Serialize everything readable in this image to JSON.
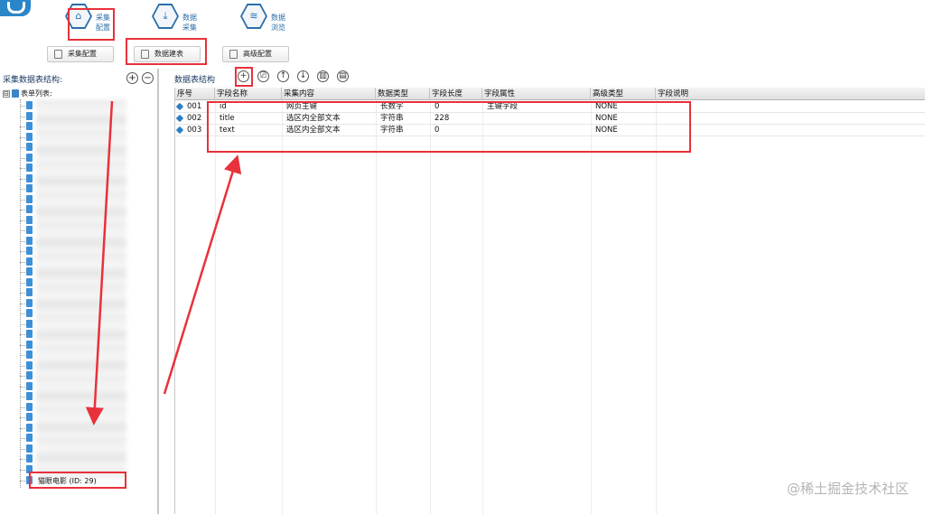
{
  "ribbon": {
    "items": [
      {
        "label": "采集\n配置",
        "icon": "home-icon"
      },
      {
        "label": "数据\n采集",
        "icon": "download-icon"
      },
      {
        "label": "数据\n浏览",
        "icon": "layers-icon"
      }
    ]
  },
  "subtabs": [
    {
      "label": "采集配置",
      "icon": "edit-icon"
    },
    {
      "label": "数据建表",
      "icon": "document-icon"
    },
    {
      "label": "高级配置",
      "icon": "grid-icon"
    }
  ],
  "left_panel": {
    "title": "采集数据表结构:",
    "add_label": "+",
    "remove_label": "−",
    "root_expander": "⊟",
    "root_label": "表单列表:",
    "last_item": "猫眼电影 (ID: 29)"
  },
  "right_panel": {
    "title": "数据表结构",
    "tools": [
      "+",
      "⎚",
      "↑",
      "↓",
      "▥",
      "▤"
    ],
    "columns": [
      "序号",
      "字段名称",
      "采集内容",
      "数据类型",
      "字段长度",
      "字段属性",
      "高级类型",
      "字段说明"
    ],
    "rows": [
      [
        "001",
        "id",
        "网页主键",
        "长数字",
        "0",
        "主键字段",
        "NONE",
        ""
      ],
      [
        "002",
        "title",
        "选区内全部文本",
        "字符串",
        "228",
        "",
        "NONE",
        ""
      ],
      [
        "003",
        "text",
        "选区内全部文本",
        "字符串",
        "0",
        "",
        "NONE",
        ""
      ]
    ]
  },
  "watermark": "@稀土掘金技术社区",
  "colors": {
    "accent": "#2b6ea8",
    "annotation_red": "#e8313a"
  }
}
